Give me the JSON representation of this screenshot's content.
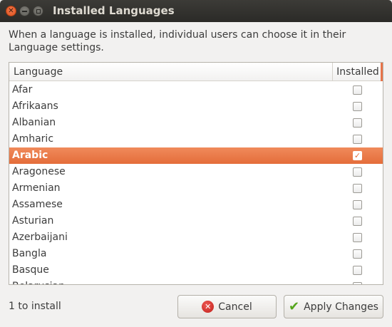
{
  "window": {
    "title": "Installed Languages"
  },
  "description": "When a language is installed, individual users can choose it in their Language settings.",
  "list": {
    "columns": {
      "language": "Language",
      "installed": "Installed"
    },
    "rows": [
      {
        "name": "Afar",
        "installed": false,
        "selected": false
      },
      {
        "name": "Afrikaans",
        "installed": false,
        "selected": false
      },
      {
        "name": "Albanian",
        "installed": false,
        "selected": false
      },
      {
        "name": "Amharic",
        "installed": false,
        "selected": false
      },
      {
        "name": "Arabic",
        "installed": true,
        "selected": true
      },
      {
        "name": "Aragonese",
        "installed": false,
        "selected": false
      },
      {
        "name": "Armenian",
        "installed": false,
        "selected": false
      },
      {
        "name": "Assamese",
        "installed": false,
        "selected": false
      },
      {
        "name": "Asturian",
        "installed": false,
        "selected": false
      },
      {
        "name": "Azerbaijani",
        "installed": false,
        "selected": false
      },
      {
        "name": "Bangla",
        "installed": false,
        "selected": false
      },
      {
        "name": "Basque",
        "installed": false,
        "selected": false
      },
      {
        "name": "Belarusian",
        "installed": false,
        "selected": false
      }
    ]
  },
  "status": "1 to install",
  "buttons": {
    "cancel": "Cancel",
    "apply": "Apply Changes"
  },
  "colors": {
    "accent": "#e46d3a",
    "titlebar": "#3c3b37",
    "check_green": "#55a51c",
    "cancel_red": "#c01f1a"
  },
  "icons": {
    "cancel": "cancel-icon",
    "apply": "checkmark-icon"
  }
}
